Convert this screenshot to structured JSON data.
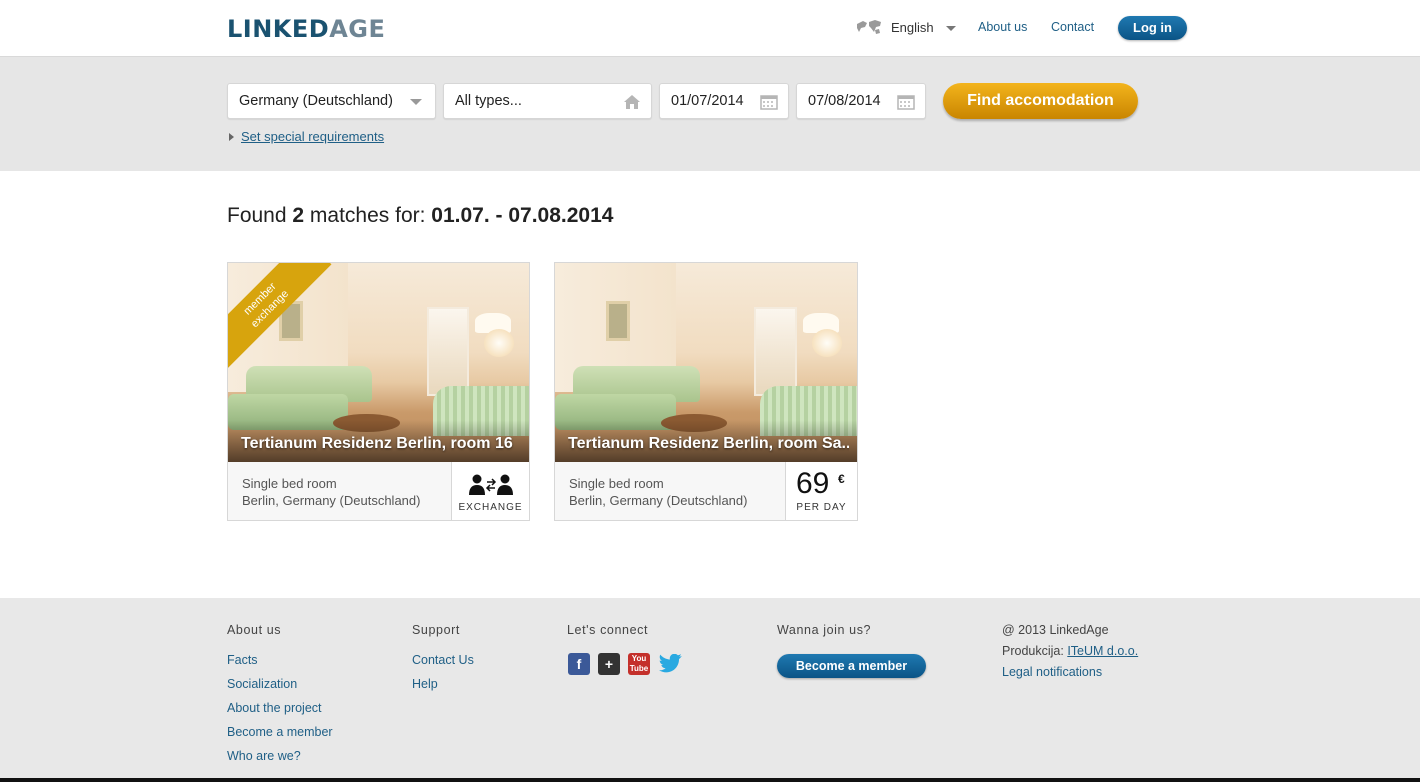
{
  "header": {
    "logo_primary": "LINKED",
    "logo_secondary": "AGE",
    "language": "English",
    "nav": [
      "About us",
      "Contact"
    ],
    "login_label": "Log in"
  },
  "search": {
    "country": "Germany (Deutschland)",
    "type_placeholder": "All types...",
    "date_from": "01/07/2014",
    "date_to": "07/08/2014",
    "find_label": "Find accomodation",
    "special_label": "Set special requirements"
  },
  "results": {
    "prefix": "Found ",
    "count": "2",
    "middle": " matches for: ",
    "range": "01.07. - 07.08.2014"
  },
  "cards": [
    {
      "ribbon": "member exchange",
      "title": "Tertianum Residenz Berlin, room 16",
      "type": "Single bed room",
      "location": "Berlin, Germany (Deutschland)",
      "badge": "EXCHANGE",
      "badge_icon": "exchange-people-icon"
    },
    {
      "title": "Tertianum Residenz Berlin, room Sa...",
      "type": "Single bed room",
      "location": "Berlin, Germany (Deutschland)",
      "price": "69",
      "currency": "€",
      "price_unit": "PER DAY"
    }
  ],
  "footer": {
    "about": {
      "heading": "About us",
      "links": [
        "Facts",
        "Socialization",
        "About the project",
        "Become a member",
        "Who are we?"
      ]
    },
    "support": {
      "heading": "Support",
      "links": [
        "Contact Us",
        "Help"
      ]
    },
    "connect": {
      "heading": "Let's connect",
      "icons": [
        "facebook-icon",
        "google-plus-icon",
        "youtube-icon",
        "twitter-icon"
      ]
    },
    "join": {
      "heading": "Wanna join us?",
      "button": "Become a member"
    },
    "legal": {
      "copyright": "@ 2013 LinkedAge",
      "production_label": "Produkcija: ",
      "production_link": "ITeUM d.o.o.",
      "legal_link": "Legal notifications"
    }
  },
  "colors": {
    "brand_blue": "#1a5270",
    "link_blue": "#1f5f86",
    "accent_gold": "#e0a30d",
    "band_gray": "#e6e6e6"
  }
}
